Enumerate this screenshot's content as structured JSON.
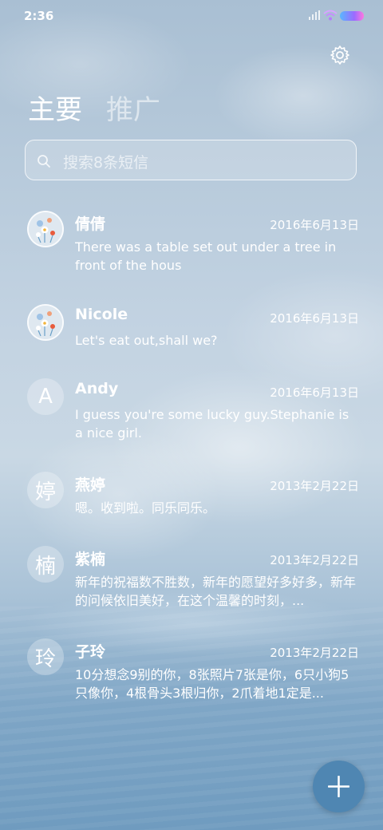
{
  "status_bar": {
    "time": "2:36"
  },
  "header": {
    "tabs": [
      {
        "label": "主要"
      },
      {
        "label": "推广"
      }
    ]
  },
  "search": {
    "placeholder": "搜索8条短信"
  },
  "conversations": [
    {
      "name": "倩倩",
      "date": "2016年6月13日",
      "preview": "There was a table set out under a tree in front of the hous",
      "avatar": "photo"
    },
    {
      "name": "Nicole",
      "date": "2016年6月13日",
      "preview": "Let's eat out,shall we?",
      "avatar": "photo"
    },
    {
      "name": "Andy",
      "date": "2016年6月13日",
      "preview": "I guess you're some lucky guy.Stephanie is a nice girl.",
      "avatar_letter": "A"
    },
    {
      "name": "燕婷",
      "date": "2013年2月22日",
      "preview": "嗯。收到啦。同乐同乐。",
      "avatar_letter": "婷"
    },
    {
      "name": "紫楠",
      "date": "2013年2月22日",
      "preview": "新年的祝福数不胜数，新年的愿望好多好多，新年的问候依旧美好，在这个温馨的时刻，...",
      "avatar_letter": "楠"
    },
    {
      "name": "子玲",
      "date": "2013年2月22日",
      "preview": "10分想念9别的你，8张照片7张是你，6只小狗5只像你，4根骨头3根归你，2爪着地1定是...",
      "avatar_letter": "玲"
    }
  ],
  "icons": {
    "settings": "gear-icon",
    "search": "search-icon",
    "compose": "plus-icon"
  }
}
